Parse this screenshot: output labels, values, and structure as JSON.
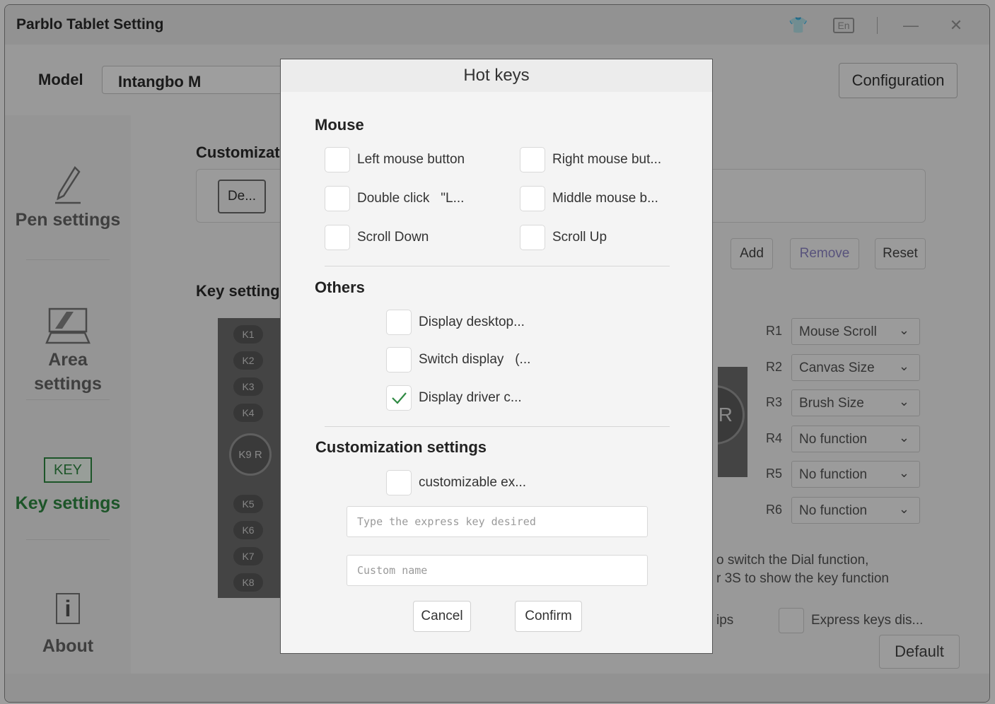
{
  "window": {
    "title": "Parblo Tablet Setting"
  },
  "titlebar_icons": [
    "shirt-icon",
    "language-icon",
    "minimize-icon",
    "close-icon"
  ],
  "titlebar_glyphs": {
    "shirt": "👕",
    "language": "En",
    "minimize": "—",
    "close": "✕"
  },
  "topbar": {
    "model_label": "Model",
    "model_value": "Intangbo M",
    "configuration_button": "Configuration"
  },
  "sidebar": {
    "items": [
      {
        "label": "Pen settings",
        "icon": "pen-icon"
      },
      {
        "label": "Area settings",
        "icon": "area-icon"
      },
      {
        "label": "Key settings",
        "icon": "key-icon",
        "icon_text": "KEY",
        "active": true
      },
      {
        "label": "About",
        "icon": "info-icon",
        "icon_text": "i"
      }
    ]
  },
  "main": {
    "customization_title": "Customizat",
    "custom_chip": "De...",
    "add_button": "Add",
    "remove_button": "Remove",
    "reset_button": "Reset",
    "key_settings_title": "Key setting",
    "left_keys": [
      "K1",
      "K2",
      "K3",
      "K4",
      "K5",
      "K6",
      "K7",
      "K8"
    ],
    "dial_label": "K9",
    "dial_r": "R",
    "right_dial_label": "R",
    "dial_settings": [
      {
        "key": "R1",
        "value": "Mouse Scroll"
      },
      {
        "key": "R2",
        "value": "Canvas Size"
      },
      {
        "key": "R3",
        "value": "Brush Size"
      },
      {
        "key": "R4",
        "value": "No function"
      },
      {
        "key": "R5",
        "value": "No function"
      },
      {
        "key": "R6",
        "value": "No function"
      }
    ],
    "hint_line1": "o switch the Dial function,",
    "hint_line2": "r 3S to show the key function",
    "tips_fragment": "ips",
    "express_keys_label": "Express keys dis...",
    "default_button": "Default"
  },
  "dialog": {
    "title": "Hot keys",
    "mouse_title": "Mouse",
    "mouse_items": [
      {
        "label": "Left mouse button",
        "checked": false
      },
      {
        "label": "Right mouse but...",
        "checked": false
      },
      {
        "label": "Double click   \"L...",
        "checked": false
      },
      {
        "label": "Middle mouse b...",
        "checked": false
      },
      {
        "label": "Scroll Down",
        "checked": false
      },
      {
        "label": "Scroll Up",
        "checked": false
      }
    ],
    "others_title": "Others",
    "others_items": [
      {
        "label": "Display desktop...",
        "checked": false
      },
      {
        "label": "Switch display   (...",
        "checked": false
      },
      {
        "label": "Display driver c...",
        "checked": true
      }
    ],
    "customization_title": "Customization settings",
    "custom_item": {
      "label": "customizable ex...",
      "checked": false
    },
    "express_key_placeholder": "Type the express key desired",
    "custom_name_placeholder": "Custom name",
    "cancel_button": "Cancel",
    "confirm_button": "Confirm"
  },
  "colors": {
    "accent_green": "#2f8a43",
    "overlay": "rgba(0,0,0,0.38)",
    "remove_disabled": "#8e86c8"
  }
}
